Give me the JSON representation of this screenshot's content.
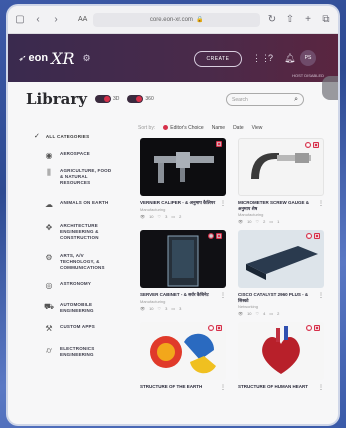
{
  "browser": {
    "reader_label": "AA",
    "url": "core.eon-xr.com",
    "icons": [
      "sidebar-icon",
      "back-icon",
      "forward-icon",
      "reload-icon",
      "share-icon",
      "new-tab-icon",
      "tabs-icon"
    ]
  },
  "header": {
    "logo_eon": "eon",
    "logo_xr": "XR",
    "create_label": "CREATE",
    "avatar_initials": "PS",
    "host_status": "HOST DISABLED"
  },
  "library": {
    "title": "Library",
    "toggle1_label": "3D",
    "toggle2_label": "360",
    "search_placeholder": "Search"
  },
  "sort": {
    "label": "Sort by:",
    "options": [
      "Editor's Choice",
      "Name",
      "Date",
      "View"
    ],
    "selected": "Editor's Choice"
  },
  "categories": {
    "all": "ALL CATEGORIES",
    "items": [
      {
        "label": "AEROSPACE",
        "icon": "aerospace-icon"
      },
      {
        "label": "AGRICULTURE, FOOD & NATURAL RESOURCES",
        "icon": "agriculture-icon"
      },
      {
        "label": "ANIMALS ON EARTH",
        "icon": "animal-icon"
      },
      {
        "label": "ARCHITECTURE ENGINEERING & CONSTRUCTION",
        "icon": "architecture-icon"
      },
      {
        "label": "ARTS, A/V TECHNOLOGY, & COMMUNICATIONS",
        "icon": "arts-icon"
      },
      {
        "label": "ASTRONOMY",
        "icon": "astronomy-icon"
      },
      {
        "label": "AUTOMOBILE ENGINEERING",
        "icon": "automobile-icon"
      },
      {
        "label": "CUSTOM APPS",
        "icon": "custom-apps-icon"
      },
      {
        "label": "ELECTRONICS ENGINEERING",
        "icon": "electronics-icon"
      }
    ]
  },
  "cards": [
    {
      "title": "VERNIER CALIPER - & अनुमाप कैलिपर",
      "sub": "Manufacturing",
      "stats": [
        "10",
        "3",
        "2"
      ]
    },
    {
      "title": "MICROMETER SCREW GAUGE & अनुमाप शेष",
      "sub": "Manufacturing",
      "stats": [
        "10",
        "2",
        "1"
      ]
    },
    {
      "title": "SERVER CABINET - & सर्वर कैबिनेट",
      "sub": "Manufacturing",
      "stats": [
        "10",
        "3",
        "3"
      ]
    },
    {
      "title": "CISCO CATALYST 2960 PLUS - & सिस्को",
      "sub": "Networking",
      "stats": [
        "10",
        "4",
        "2"
      ]
    },
    {
      "title": "STRUCTURE OF THE EARTH",
      "sub": "",
      "stats": []
    },
    {
      "title": "STRUCTURE OF HUMAN HEART",
      "sub": "",
      "stats": []
    }
  ]
}
